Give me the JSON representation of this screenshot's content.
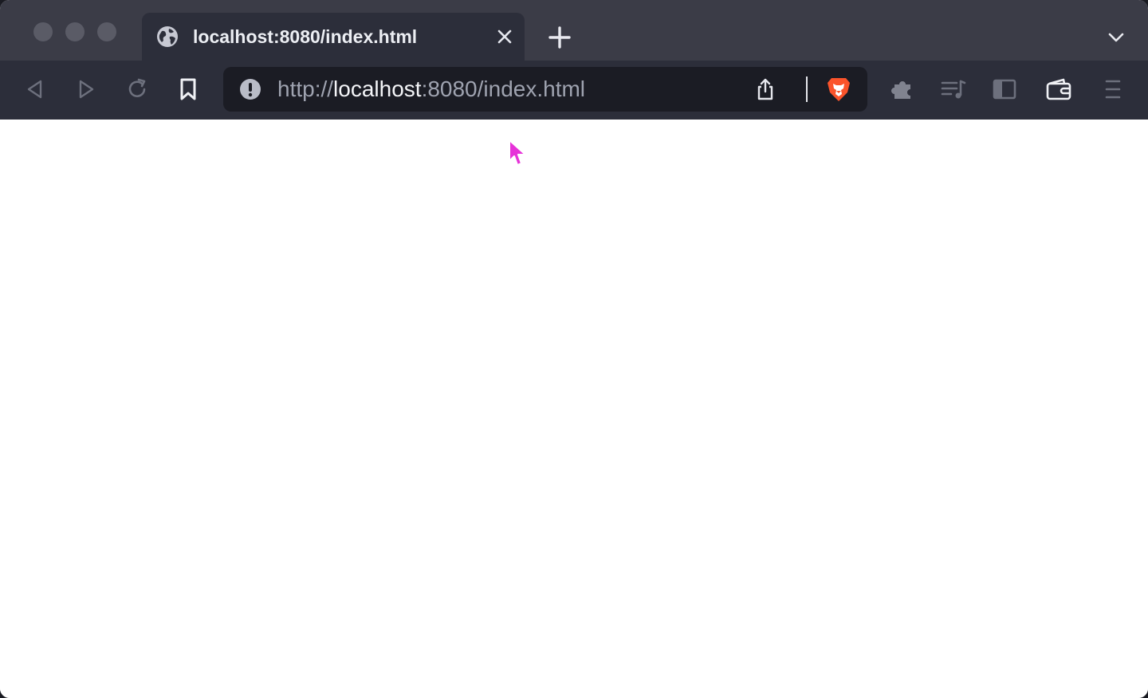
{
  "tab": {
    "title": "localhost:8080/index.html",
    "favicon_icon": "globe-icon",
    "close_icon": "close-icon"
  },
  "tabstrip": {
    "new_tab_icon": "plus-icon",
    "tab_list_icon": "chevron-down-icon"
  },
  "toolbar": {
    "back_icon": "back-icon",
    "forward_icon": "forward-icon",
    "reload_icon": "reload-icon",
    "bookmark_icon": "bookmark-icon",
    "extensions_icon": "puzzle-icon",
    "playlist_icon": "playlist-icon",
    "sidebar_icon": "sidebar-icon",
    "wallet_icon": "wallet-icon",
    "menu_icon": "hamburger-menu-icon"
  },
  "address_bar": {
    "scheme": "http://",
    "host": "localhost",
    "rest": ":8080/index.html",
    "site_info_icon": "info-warning-icon",
    "share_icon": "share-icon",
    "shields_icon": "brave-lion-icon"
  },
  "colors": {
    "tabstrip_bg": "#3b3c47",
    "toolbar_bg": "#2c2e3a",
    "omnibox_bg": "#1b1c24",
    "page_bg": "#ffffff",
    "cursor": "#e632d8",
    "brave_orange": "#fb542b"
  }
}
